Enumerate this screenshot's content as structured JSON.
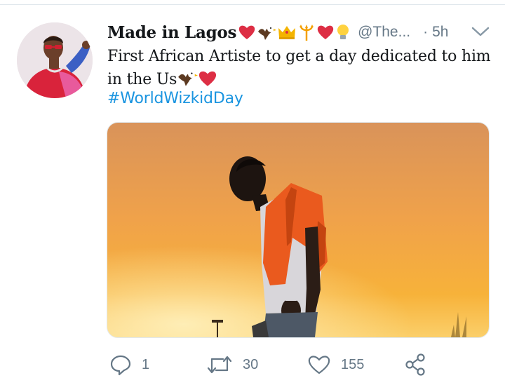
{
  "tweet": {
    "author_name": "Made in Lagos",
    "name_emojis": [
      "red-heart",
      "eagle",
      "crown",
      "trident",
      "red-heart",
      "light-bulb"
    ],
    "handle": "@The...",
    "separator": "·",
    "timestamp": "5h",
    "text_line1": "First African Artiste to get a day dedicated to him",
    "text_line2": "in the Us",
    "text_emojis": [
      "eagle",
      "red-heart"
    ],
    "hashtag": "#WorldWizkidDay"
  },
  "actions": {
    "reply_count": "1",
    "retweet_count": "30",
    "like_count": "155"
  },
  "icons": {
    "reply": "reply-icon",
    "retweet": "retweet-icon",
    "like": "heart-icon",
    "share": "share-icon",
    "menu": "chevron-down-icon"
  },
  "colors": {
    "link": "#1b95e0",
    "secondary_text": "#657786",
    "primary_text": "#14171a",
    "divider": "#e1e8ed"
  }
}
